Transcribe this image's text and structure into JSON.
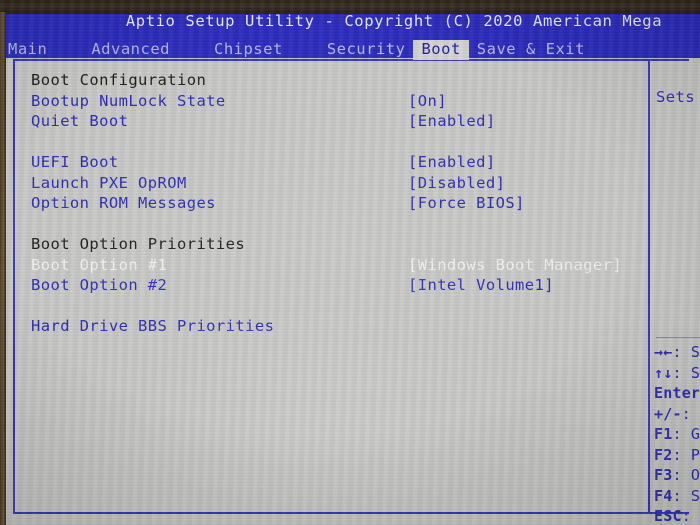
{
  "colors": {
    "header_blue": "#2a2abe",
    "panel_gray": "#c9c9c7",
    "item_blue": "#2b2bb4",
    "heading_dark": "#1d1d1d",
    "selected_white": "#f2f2f2",
    "border_blue": "#3535c4"
  },
  "header": {
    "title": "Aptio Setup Utility - Copyright (C) 2020 American Mega",
    "tabs": [
      {
        "label": "Main",
        "active": false
      },
      {
        "label": "Advanced",
        "active": false
      },
      {
        "label": "Chipset",
        "active": false
      },
      {
        "label": "Security",
        "active": false
      },
      {
        "label": "Boot",
        "active": true
      },
      {
        "label": "Save & Exit",
        "active": false
      }
    ]
  },
  "main": {
    "sections": [
      {
        "heading": "Boot Configuration",
        "items": [
          {
            "label": "Bootup NumLock State",
            "value": "[On]",
            "selected": false
          },
          {
            "label": "Quiet Boot",
            "value": "[Enabled]",
            "selected": false
          }
        ]
      },
      {
        "heading": "",
        "items": [
          {
            "label": "UEFI Boot",
            "value": "[Enabled]",
            "selected": false
          },
          {
            "label": "Launch PXE OpROM",
            "value": "[Disabled]",
            "selected": false
          },
          {
            "label": "Option ROM Messages",
            "value": "[Force BIOS]",
            "selected": false
          }
        ]
      },
      {
        "heading": "Boot Option Priorities",
        "items": [
          {
            "label": "Boot Option #1",
            "value": "[Windows Boot Manager]",
            "selected": true
          },
          {
            "label": "Boot Option #2",
            "value": "[Intel Volume1]",
            "selected": false
          }
        ]
      }
    ],
    "submenu": {
      "label": "Hard Drive BBS Priorities"
    }
  },
  "help": {
    "description": "Sets",
    "keys": [
      {
        "symbol": "→←",
        "text": ": Se"
      },
      {
        "symbol": "↑↓",
        "text": ": Se"
      },
      {
        "symbol": "Enter",
        "text": ":"
      },
      {
        "symbol": "+/-",
        "text": ": C"
      },
      {
        "symbol": "F1",
        "text": ": Ge"
      },
      {
        "symbol": "F2",
        "text": ": Pr"
      },
      {
        "symbol": "F3",
        "text": ": Op"
      },
      {
        "symbol": "F4",
        "text": ": Sa"
      },
      {
        "symbol": "ESC",
        "text": ": E"
      }
    ]
  }
}
